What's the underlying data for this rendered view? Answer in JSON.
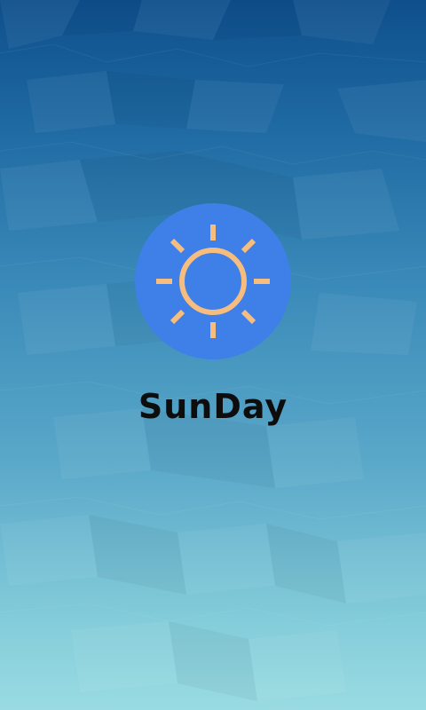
{
  "app": {
    "name": "SunDay"
  },
  "logo": {
    "icon": "sun-icon",
    "circle_color": "#3f7fe8",
    "sun_color": "#f7bd7f"
  },
  "background": {
    "top_color": "#0e4f8c",
    "bottom_color": "#9adbe2"
  }
}
